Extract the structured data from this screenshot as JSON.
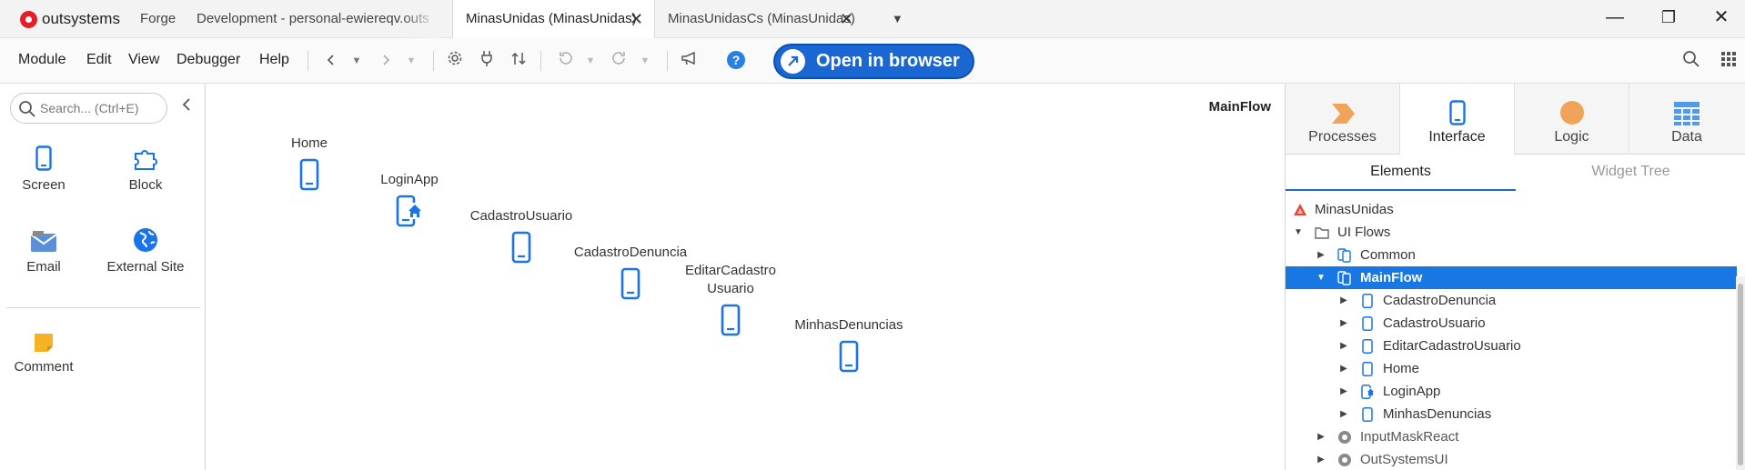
{
  "titlebar": {
    "logo_text": "outsystems",
    "tabs": [
      {
        "label": "Forge"
      },
      {
        "label": "Development - personal-ewiereqv.outs"
      },
      {
        "label": "MinasUnidas (MinasUnidas)",
        "close": "✕"
      },
      {
        "label": "MinasUnidasCs (MinasUnidas)",
        "close": "✕"
      }
    ],
    "overflow": "▼",
    "window_buttons": {
      "minimize": "—",
      "maximize": "❐",
      "close": "✕"
    }
  },
  "menubar": {
    "items": [
      "Module",
      "Edit",
      "View",
      "Debugger",
      "Help"
    ],
    "open_browser_label": "Open in browser",
    "help_label": "?"
  },
  "toolbox": {
    "search_placeholder": "Search... (Ctrl+E)",
    "items": [
      {
        "label": "Screen",
        "icon": "screen-icon"
      },
      {
        "label": "Block",
        "icon": "block-icon"
      },
      {
        "label": "Email",
        "icon": "email-icon"
      },
      {
        "label": "External Site",
        "icon": "globe-icon"
      },
      {
        "label": "Comment",
        "icon": "sticky-note-icon"
      }
    ]
  },
  "canvas": {
    "flow_title": "MainFlow",
    "nodes": [
      {
        "label": "Home",
        "icon": "screen-icon"
      },
      {
        "label": "LoginApp",
        "icon": "home-screen-icon"
      },
      {
        "label": "CadastroUsuario",
        "icon": "screen-icon"
      },
      {
        "label": "CadastroDenuncia",
        "icon": "screen-icon"
      },
      {
        "label": "EditarCadastro Usuario",
        "icon": "screen-icon"
      },
      {
        "label": "MinhasDenuncias",
        "icon": "screen-icon"
      }
    ]
  },
  "rightpanel": {
    "tabs": [
      {
        "label": "Processes",
        "icon": "processes-icon"
      },
      {
        "label": "Interface",
        "icon": "interface-icon",
        "active": true
      },
      {
        "label": "Logic",
        "icon": "logic-icon"
      },
      {
        "label": "Data",
        "icon": "data-icon"
      }
    ],
    "subtabs": [
      {
        "label": "Elements",
        "active": true
      },
      {
        "label": "Widget Tree"
      }
    ],
    "tree": [
      {
        "label": "MinasUnidas",
        "icon": "module-icon",
        "arrow": ""
      },
      {
        "label": "UI Flows",
        "icon": "folder-icon",
        "arrow": "▼"
      },
      {
        "label": "Common",
        "icon": "flow-icon",
        "arrow": "▶"
      },
      {
        "label": "MainFlow",
        "icon": "flow-icon",
        "arrow": "▼",
        "selected": true
      },
      {
        "label": "CadastroDenuncia",
        "icon": "screen-icon",
        "arrow": "▶"
      },
      {
        "label": "CadastroUsuario",
        "icon": "screen-icon",
        "arrow": "▶"
      },
      {
        "label": "EditarCadastroUsuario",
        "icon": "screen-icon",
        "arrow": "▶"
      },
      {
        "label": "Home",
        "icon": "screen-icon",
        "arrow": "▶"
      },
      {
        "label": "LoginApp",
        "icon": "home-screen-icon",
        "arrow": "▶"
      },
      {
        "label": "MinhasDenuncias",
        "icon": "screen-icon",
        "arrow": "▶"
      },
      {
        "label": "InputMaskReact",
        "icon": "dependency-icon",
        "arrow": "▶"
      },
      {
        "label": "OutSystemsUI",
        "icon": "dependency-icon",
        "arrow": "▶"
      }
    ]
  },
  "colors": {
    "accent": "#1a66d2",
    "selection": "#1778e3",
    "brand_red": "#e61e28",
    "comment_yellow": "#f5b223",
    "process_orange": "#f0a45a"
  }
}
